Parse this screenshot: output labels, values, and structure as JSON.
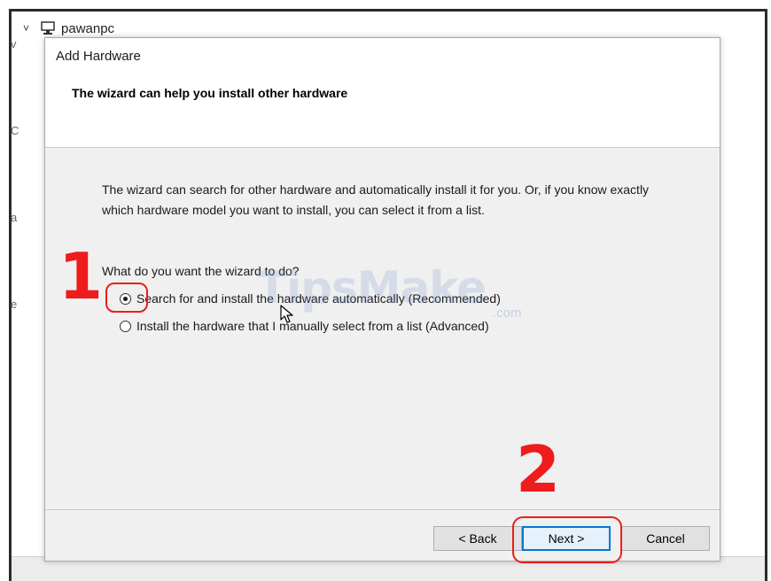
{
  "background": {
    "tree_root_label": "pawanpc",
    "left_marks": [
      "v",
      "C",
      "a",
      "e"
    ]
  },
  "dialog": {
    "title": "Add Hardware",
    "heading": "The wizard can help you install other hardware",
    "description": "The wizard can search for other hardware and automatically install it for you. Or, if you know exactly which hardware model you want to install, you can select it from a list.",
    "question": "What do you want the wizard to do?",
    "options": [
      {
        "label": "Search for and install the hardware automatically (Recommended)",
        "selected": true
      },
      {
        "label": "Install the hardware that I manually select from a list (Advanced)",
        "selected": false
      }
    ],
    "buttons": {
      "back": "< Back",
      "next": "Next >",
      "cancel": "Cancel"
    }
  },
  "annotations": {
    "step1": "1",
    "step2": "2",
    "color": "#ee1c1c"
  },
  "watermark": {
    "text": "TipsMake",
    "suffix": ".com"
  },
  "icons": {
    "tree_chevron": "chevron-down-icon",
    "computer": "computer-icon",
    "mouse_cursor": "cursor-icon"
  }
}
